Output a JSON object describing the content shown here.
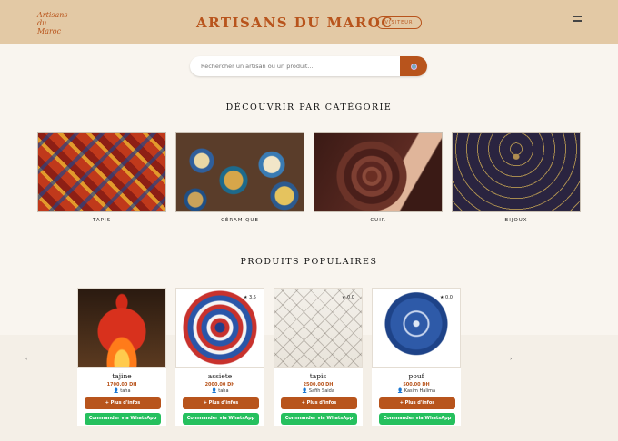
{
  "header": {
    "logo_line1": "Artisans",
    "logo_line2": "du Maroc",
    "title": "ARTISANS DU MAROC",
    "badge": "VISITEUR"
  },
  "search": {
    "placeholder": "Rechercher un artisan ou un produit..."
  },
  "categories_section": {
    "title": "DÉCOUVRIR PAR CATÉGORIE",
    "items": [
      {
        "label": "TAPIS"
      },
      {
        "label": "CÉRAMIQUE"
      },
      {
        "label": "CUIR"
      },
      {
        "label": "BIJOUX"
      }
    ]
  },
  "products_section": {
    "title": "PRODUITS POPULAIRES",
    "prev": "‹",
    "next": "›",
    "items": [
      {
        "name": "tajine",
        "price": "1700.00 DH",
        "seller": "taha",
        "rating": "",
        "info_label": "+ Plus d'infos",
        "whatsapp_label": "Commander via WhatsApp"
      },
      {
        "name": "assiete",
        "price": "2000.00 DH",
        "seller": "taha",
        "rating": "★ 3.5",
        "info_label": "+ Plus d'infos",
        "whatsapp_label": "Commander via WhatsApp"
      },
      {
        "name": "tapis",
        "price": "2500.00 DH",
        "seller": "Safih Saida",
        "rating": "★ 0.0",
        "info_label": "+ Plus d'infos",
        "whatsapp_label": "Commander via WhatsApp"
      },
      {
        "name": "pouf",
        "price": "500.00 DH",
        "seller": "Kasim Halima",
        "rating": "★ 0.0",
        "info_label": "+ Plus d'infos",
        "whatsapp_label": "Commander via WhatsApp"
      }
    ]
  },
  "colors": {
    "header_bg": "#e3c9a5",
    "accent": "#b8541c",
    "whatsapp": "#25c05e"
  }
}
